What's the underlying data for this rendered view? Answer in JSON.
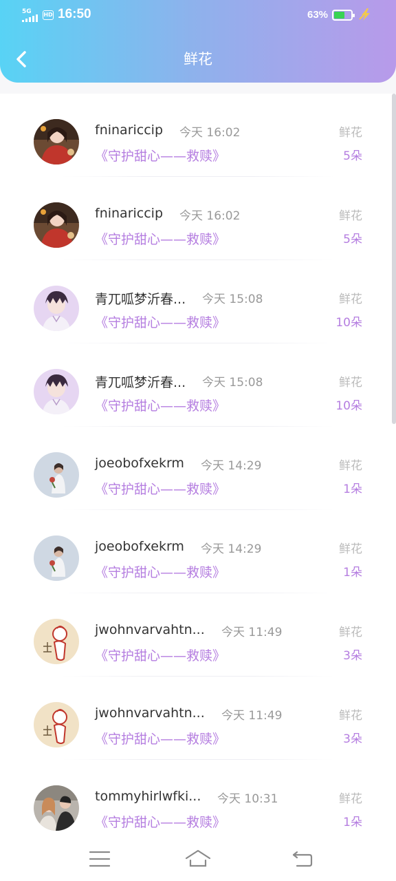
{
  "status_bar": {
    "network": "5G",
    "hd": "HD",
    "time": "16:50",
    "battery_percent": "63%",
    "battery_level": 0.63,
    "battery_color": "#39d353"
  },
  "header": {
    "title": "鲜花",
    "back_icon": "chevron-left-icon"
  },
  "records": [
    {
      "avatar": "girl-red-sweater",
      "name": "fninariccip",
      "time": "今天 16:02",
      "book": "《守护甜心——救赎》",
      "label": "鲜花",
      "count": "5朵"
    },
    {
      "avatar": "girl-red-sweater",
      "name": "fninariccip",
      "time": "今天 16:02",
      "book": "《守护甜心——救赎》",
      "label": "鲜花",
      "count": "5朵"
    },
    {
      "avatar": "anime-boy",
      "name": "青兀呱梦沂春...",
      "time": "今天 15:08",
      "book": "《守护甜心——救赎》",
      "label": "鲜花",
      "count": "10朵"
    },
    {
      "avatar": "anime-boy",
      "name": "青兀呱梦沂春...",
      "time": "今天 15:08",
      "book": "《守护甜心——救赎》",
      "label": "鲜花",
      "count": "10朵"
    },
    {
      "avatar": "girl-with-flowers",
      "name": "joeobofxekrm",
      "time": "今天 14:29",
      "book": "《守护甜心——救赎》",
      "label": "鲜花",
      "count": "1朵"
    },
    {
      "avatar": "girl-with-flowers",
      "name": "joeobofxekrm",
      "time": "今天 14:29",
      "book": "《守护甜心——救赎》",
      "label": "鲜花",
      "count": "1朵"
    },
    {
      "avatar": "cartoon-sketch",
      "name": "jwohnvarvahtn...",
      "time": "今天 11:49",
      "book": "《守护甜心——救赎》",
      "label": "鲜花",
      "count": "3朵"
    },
    {
      "avatar": "cartoon-sketch",
      "name": "jwohnvarvahtn...",
      "time": "今天 11:49",
      "book": "《守护甜心——救赎》",
      "label": "鲜花",
      "count": "3朵"
    },
    {
      "avatar": "couple-photo",
      "name": "tommyhirlwfki...",
      "time": "今天 10:31",
      "book": "《守护甜心——救赎》",
      "label": "鲜花",
      "count": "1朵"
    }
  ],
  "nav": {
    "menu_icon": "menu-icon",
    "home_icon": "home-icon",
    "back_icon": "return-icon"
  },
  "colors": {
    "header_start": "#58d3f5",
    "header_end": "#b89aea",
    "accent": "#b57ee0"
  }
}
